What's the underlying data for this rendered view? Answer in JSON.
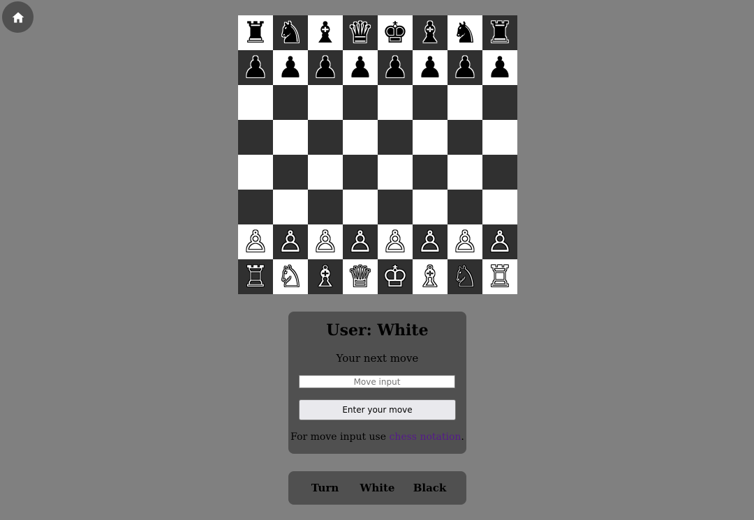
{
  "home": {
    "icon": "home-icon"
  },
  "board": {
    "light_color": "#ffffff",
    "dark_color": "#303030",
    "ranks": [
      [
        "♜",
        "♞",
        "♝",
        "♛",
        "♚",
        "♝",
        "♞",
        "♜"
      ],
      [
        "♟",
        "♟",
        "♟",
        "♟",
        "♟",
        "♟",
        "♟",
        "♟"
      ],
      [
        "",
        "",
        "",
        "",
        "",
        "",
        "",
        ""
      ],
      [
        "",
        "",
        "",
        "",
        "",
        "",
        "",
        ""
      ],
      [
        "",
        "",
        "",
        "",
        "",
        "",
        "",
        ""
      ],
      [
        "",
        "",
        "",
        "",
        "",
        "",
        "",
        ""
      ],
      [
        "♙",
        "♙",
        "♙",
        "♙",
        "♙",
        "♙",
        "♙",
        "♙"
      ],
      [
        "♖",
        "♘",
        "♗",
        "♕",
        "♔",
        "♗",
        "♘",
        "♖"
      ]
    ],
    "colors": [
      [
        "black",
        "black",
        "black",
        "black",
        "black",
        "black",
        "black",
        "black"
      ],
      [
        "black",
        "black",
        "black",
        "black",
        "black",
        "black",
        "black",
        "black"
      ],
      [
        "",
        "",
        "",
        "",
        "",
        "",
        "",
        ""
      ],
      [
        "",
        "",
        "",
        "",
        "",
        "",
        "",
        ""
      ],
      [
        "",
        "",
        "",
        "",
        "",
        "",
        "",
        ""
      ],
      [
        "",
        "",
        "",
        "",
        "",
        "",
        "",
        ""
      ],
      [
        "white",
        "white",
        "white",
        "white",
        "white",
        "white",
        "white",
        "white"
      ],
      [
        "white",
        "white",
        "white",
        "white",
        "white",
        "white",
        "white",
        "white"
      ]
    ]
  },
  "panel": {
    "title": "User: White",
    "subtitle": "Your next move",
    "input_placeholder": "Move input",
    "input_value": "",
    "button_label": "Enter your move",
    "help_prefix": "For move input use ",
    "help_link": "chess notation",
    "help_suffix": "."
  },
  "turn": {
    "label": "Turn",
    "white": "White",
    "black": "Black"
  }
}
